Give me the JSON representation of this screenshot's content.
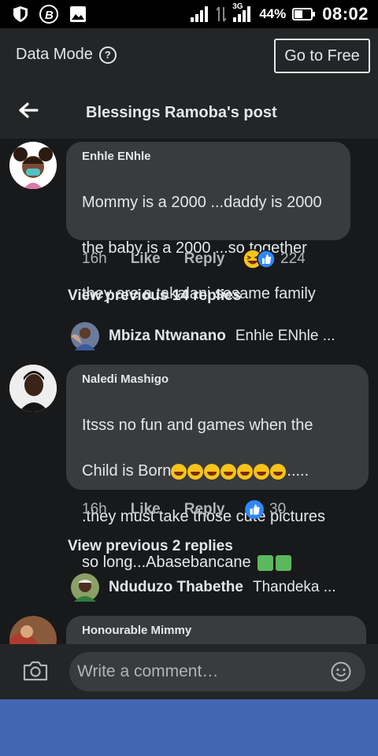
{
  "status_bar": {
    "network": "3G",
    "battery": "44%",
    "time": "08:02"
  },
  "data_mode": {
    "label": "Data Mode",
    "info_icon": "?",
    "go_free_button": "Go to Free"
  },
  "header": {
    "title": "Blessings Ramoba's post"
  },
  "comments": [
    {
      "author": "Enhle ENhle",
      "line1": "Mommy is a 2000 ...daddy is 2000",
      "line2": "the baby is a 2000 ...so together",
      "line3": "they are a takalani sesame family",
      "time": "16h",
      "like": "Like",
      "reply": "Reply",
      "reaction_count": "224"
    },
    {
      "author": "Naledi Mashigo",
      "line1": "Itsss no fun and games when the",
      "line2a": "Child is Born",
      "line2b": ".....",
      "line3": ".they must take those cute pictures",
      "line4": "so long...Abasebancane",
      "time": "16h",
      "like": "Like",
      "reply": "Reply",
      "reaction_count": "30"
    },
    {
      "author": "Honourable Mimmy"
    }
  ],
  "view_previous": [
    {
      "label": "View previous 14 replies"
    },
    {
      "label": "View previous 2 replies"
    }
  ],
  "reply_previews": [
    {
      "name": "Mbiza Ntwanano",
      "text": "Enhle ENhle ..."
    },
    {
      "name": "Nduduzo Thabethe",
      "text": "Thandeka ..."
    }
  ],
  "composer": {
    "placeholder": "Write a comment…"
  },
  "icons": {
    "shield": "shield-icon",
    "b_badge": "b-app-icon",
    "image": "gallery-icon",
    "back": "back-arrow-icon",
    "camera": "camera-icon",
    "smiley": "smiley-icon"
  }
}
